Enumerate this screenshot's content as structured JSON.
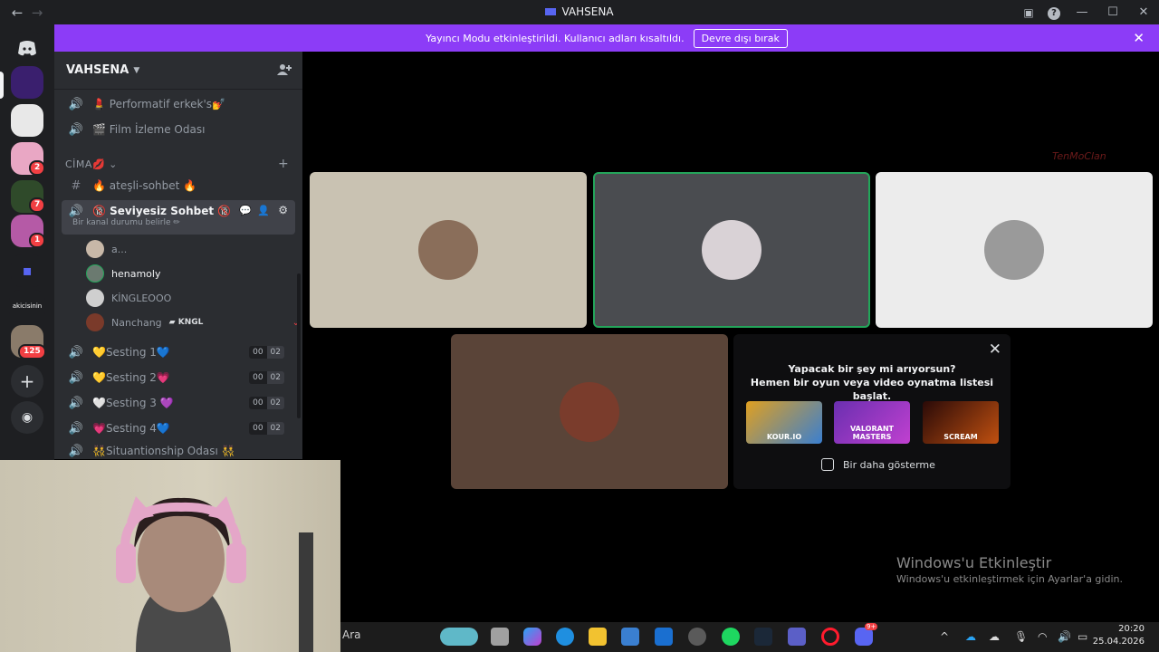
{
  "window": {
    "title": "VAHSENA",
    "help_glyph": "?"
  },
  "banner": {
    "text": "Yayıncı Modu etkinleştirildi. Kullanıcı adları kısaltıldı.",
    "button": "Devre dışı bırak"
  },
  "rail": {
    "badges": [
      "2",
      "7",
      "1",
      "125"
    ],
    "server_labels": [
      "akicisinin"
    ]
  },
  "sidebar": {
    "server_name": "VAHSENA",
    "voice_top": [
      {
        "label": "💄 Performatif erkek's💅"
      },
      {
        "label": "🎬 Film İzleme Odası"
      }
    ],
    "category": "CİMA💋",
    "text_channel": "🔥 ateşli-sohbet 🔥",
    "active": {
      "label": "🔞 Seviyesiz Sohbet 🔞",
      "status": "Bir kanal durumu belirle ✏"
    },
    "users": [
      {
        "name": "a..."
      },
      {
        "name": "henamoly"
      },
      {
        "name": "KİNGLEOOO"
      },
      {
        "name": "Nanchang",
        "tag": "KNGL"
      }
    ],
    "sesting": [
      {
        "label": "💛Sesting 1💙",
        "a": "00",
        "b": "02"
      },
      {
        "label": "💛Sesting 2💗",
        "a": "00",
        "b": "02"
      },
      {
        "label": "🤍Sesting 3 💜",
        "a": "00",
        "b": "02"
      },
      {
        "label": "💗Sesting 4💙",
        "a": "00",
        "b": "02"
      }
    ],
    "last": "👯Situantionship Odası 👯"
  },
  "stage": {
    "watermark": "TenMoClan",
    "promo": {
      "line1": "Yapacak bir şey mi arıyorsun?",
      "line2": "Hemen bir oyun veya video oynatma listesi başlat.",
      "games": [
        "KOUR.IO",
        "VALORANT MASTERS",
        "SCREAM"
      ],
      "checkbox": "Bir daha gösterme"
    }
  },
  "activation": {
    "title": "Windows'u Etkinleştir",
    "subtitle": "Windows'u etkinleştirmek için Ayarlar'a gidin."
  },
  "taskbar": {
    "search": "Ara",
    "badge": "9+",
    "time": "20:20",
    "date": "25.04.2026"
  }
}
